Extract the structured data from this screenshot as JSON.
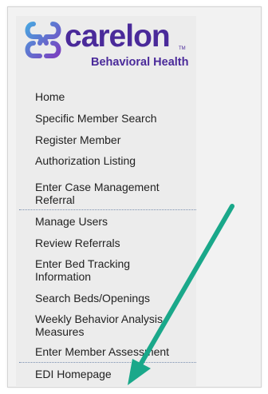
{
  "logo": {
    "brand": "carelon",
    "trademark": "TM",
    "tagline": "Behavioral Health",
    "colors": {
      "brand_purple": "#4a2a9a",
      "mark_blue": "#4aa3df",
      "mark_purple": "#7b3fbf"
    }
  },
  "nav": {
    "items": [
      {
        "label": "Home"
      },
      {
        "label": "Specific Member Search"
      },
      {
        "label": "Register Member"
      },
      {
        "label": "Authorization Listing"
      },
      {
        "label": "Enter Case Management Referral"
      },
      {
        "label": "Manage Users"
      },
      {
        "label": "Review Referrals"
      },
      {
        "label": "Enter Bed Tracking Information"
      },
      {
        "label": "Search Beds/Openings"
      },
      {
        "label": "Weekly Behavior Analysis Measures"
      },
      {
        "label": "Enter Member Assessment"
      },
      {
        "label": "EDI Homepage"
      }
    ]
  },
  "annotation": {
    "arrow_color": "#1aa88a",
    "arrow_icon": "arrow-pointer-icon"
  }
}
